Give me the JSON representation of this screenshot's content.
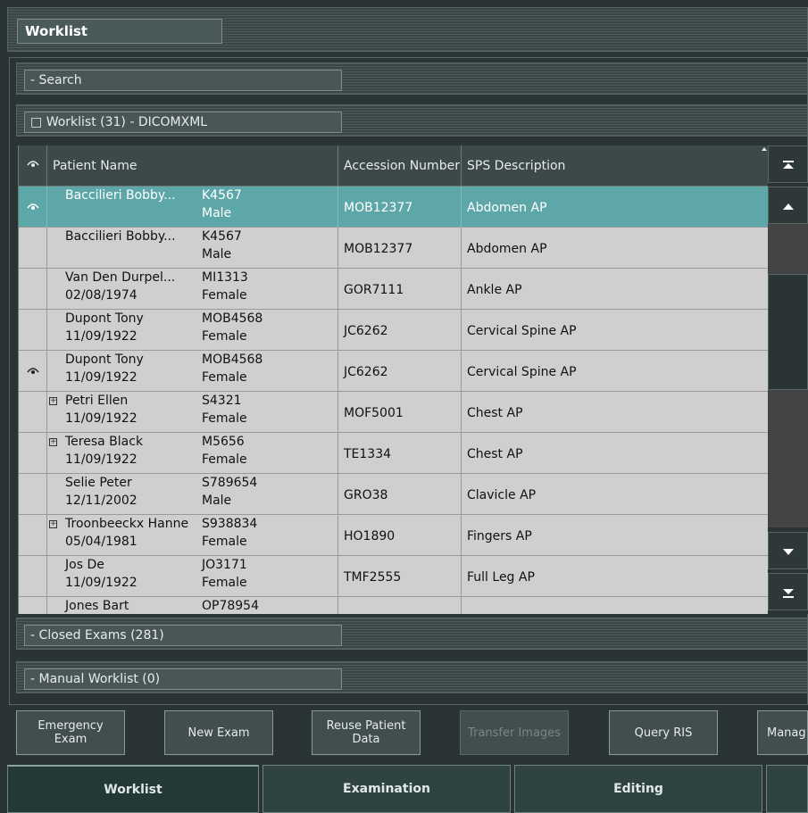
{
  "window": {
    "title": "Worklist"
  },
  "sections": {
    "search": {
      "label": "Search",
      "expander": "-"
    },
    "worklist": {
      "label": "Worklist (31) - DICOMXML",
      "expander": "□"
    },
    "closed": {
      "label": "Closed Exams (281)",
      "expander": "-"
    },
    "manual": {
      "label": "Manual Worklist (0)",
      "expander": "-"
    }
  },
  "table": {
    "headers": {
      "icon": "eye-icon",
      "patient_name": "Patient Name",
      "accession": "Accession Number",
      "sps": "SPS Description"
    },
    "rows": [
      {
        "name": "Baccilieri  Bobby...",
        "dob": "",
        "id": "K4567",
        "sex": "Male",
        "accession": "MOB12377",
        "sps": "Abdomen AP",
        "viewed": true,
        "expandable": false,
        "selected": true
      },
      {
        "name": "Baccilieri  Bobby...",
        "dob": "",
        "id": "K4567",
        "sex": "Male",
        "accession": "MOB12377",
        "sps": "Abdomen AP",
        "viewed": false,
        "expandable": false,
        "selected": false
      },
      {
        "name": "Van Den Durpel...",
        "dob": "02/08/1974",
        "id": "MI1313",
        "sex": "Female",
        "accession": "GOR7111",
        "sps": "Ankle AP",
        "viewed": false,
        "expandable": false,
        "selected": false
      },
      {
        "name": "Dupont Tony",
        "dob": "11/09/1922",
        "id": "MOB4568",
        "sex": "Female",
        "accession": "JC6262",
        "sps": "Cervical Spine AP",
        "viewed": false,
        "expandable": false,
        "selected": false
      },
      {
        "name": "Dupont Tony",
        "dob": "11/09/1922",
        "id": "MOB4568",
        "sex": "Female",
        "accession": "JC6262",
        "sps": "Cervical Spine AP",
        "viewed": true,
        "expandable": false,
        "selected": false
      },
      {
        "name": "Petri Ellen",
        "dob": "11/09/1922",
        "id": "S4321",
        "sex": "Female",
        "accession": "MOF5001",
        "sps": "Chest AP",
        "viewed": false,
        "expandable": true,
        "selected": false
      },
      {
        "name": "Teresa Black",
        "dob": "11/09/1922",
        "id": "M5656",
        "sex": "Female",
        "accession": "TE1334",
        "sps": "Chest AP",
        "viewed": false,
        "expandable": true,
        "selected": false
      },
      {
        "name": "Selie Peter",
        "dob": "12/11/2002",
        "id": "S789654",
        "sex": "Male",
        "accession": "GRO38",
        "sps": "Clavicle AP",
        "viewed": false,
        "expandable": false,
        "selected": false
      },
      {
        "name": "Troonbeeckx Hanne",
        "dob": "05/04/1981",
        "id": "S938834",
        "sex": "Female",
        "accession": "HO1890",
        "sps": "Fingers AP",
        "viewed": false,
        "expandable": true,
        "selected": false
      },
      {
        "name": "Jos De",
        "dob": "11/09/1922",
        "id": "JO3171",
        "sex": "Female",
        "accession": "TMF2555",
        "sps": "Full Leg AP",
        "viewed": false,
        "expandable": false,
        "selected": false
      },
      {
        "name": "Jones Bart",
        "dob": "",
        "id": "OP78954",
        "sex": "",
        "accession": "",
        "sps": "",
        "viewed": false,
        "expandable": false,
        "selected": false
      }
    ]
  },
  "toolbar": {
    "emergency": "Emergency\nExam",
    "new_exam": "New Exam",
    "reuse": "Reuse Patient\nData",
    "transfer": "Transfer Images",
    "query": "Query RIS",
    "manage": "Manag"
  },
  "nav": {
    "worklist": "Worklist",
    "examination": "Examination",
    "editing": "Editing"
  },
  "colors": {
    "selected_row": "#5da7a8",
    "background": "#2b3434",
    "grid": "#cfcfcf"
  }
}
